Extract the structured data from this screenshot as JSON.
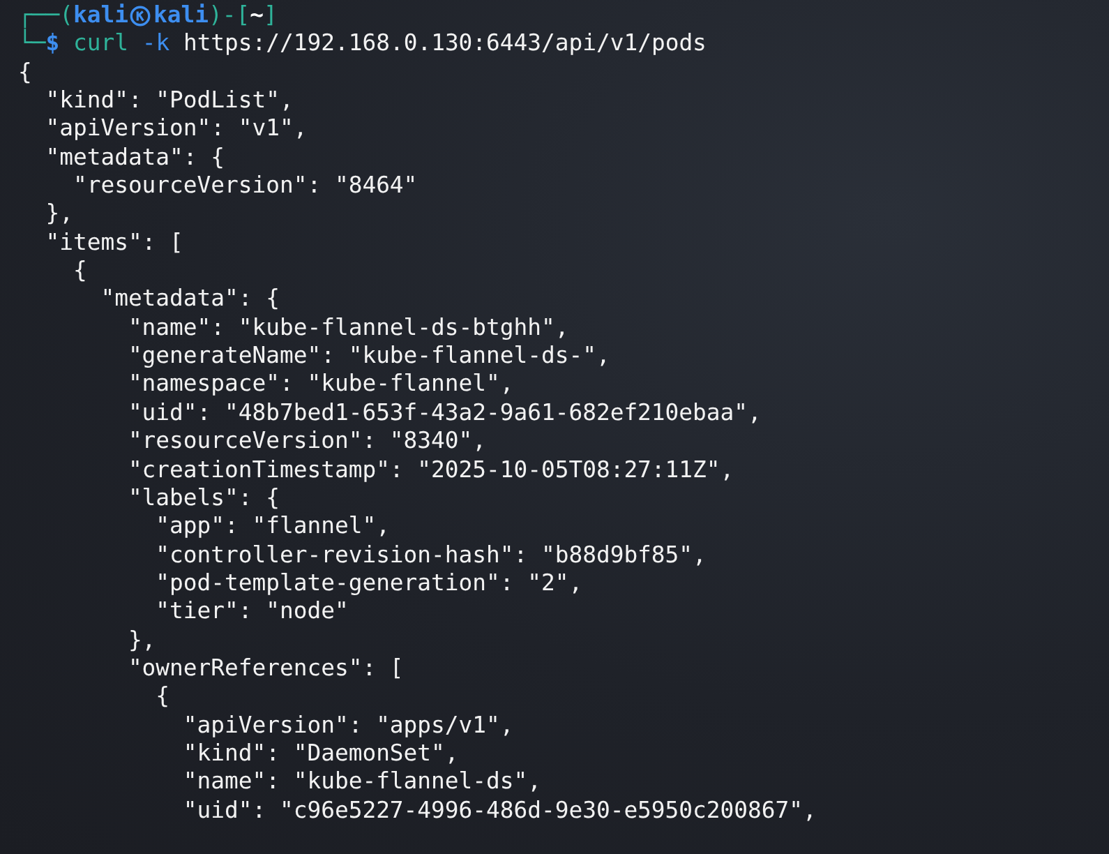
{
  "prompt": {
    "line1": [
      {
        "kind": "frame",
        "text": "┌──("
      },
      {
        "kind": "user",
        "text": "kali"
      },
      {
        "kind": "symbol"
      },
      {
        "kind": "user",
        "text": "kali"
      },
      {
        "kind": "frame",
        "text": ")-["
      },
      {
        "kind": "cwd",
        "text": "~"
      },
      {
        "kind": "frame",
        "text": "]"
      }
    ],
    "line2": [
      {
        "kind": "frame",
        "text": "└─"
      },
      {
        "kind": "dollar",
        "text": "$"
      },
      {
        "kind": "command",
        "text": " curl"
      },
      {
        "kind": "option",
        "text": " -k"
      },
      {
        "kind": "argument",
        "text": " https://192.168.0.130:6443/api/v1/pods"
      }
    ]
  },
  "output": [
    "{",
    "  \"kind\": \"PodList\",",
    "  \"apiVersion\": \"v1\",",
    "  \"metadata\": {",
    "    \"resourceVersion\": \"8464\"",
    "  },",
    "  \"items\": [",
    "    {",
    "      \"metadata\": {",
    "        \"name\": \"kube-flannel-ds-btghh\",",
    "        \"generateName\": \"kube-flannel-ds-\",",
    "        \"namespace\": \"kube-flannel\",",
    "        \"uid\": \"48b7bed1-653f-43a2-9a61-682ef210ebaa\",",
    "        \"resourceVersion\": \"8340\",",
    "        \"creationTimestamp\": \"2025-10-05T08:27:11Z\",",
    "        \"labels\": {",
    "          \"app\": \"flannel\",",
    "          \"controller-revision-hash\": \"b88d9bf85\",",
    "          \"pod-template-generation\": \"2\",",
    "          \"tier\": \"node\"",
    "        },",
    "        \"ownerReferences\": [",
    "          {",
    "            \"apiVersion\": \"apps/v1\",",
    "            \"kind\": \"DaemonSet\",",
    "            \"name\": \"kube-flannel-ds\",",
    "            \"uid\": \"c96e5227-4996-486d-9e30-e5950c200867\","
  ]
}
